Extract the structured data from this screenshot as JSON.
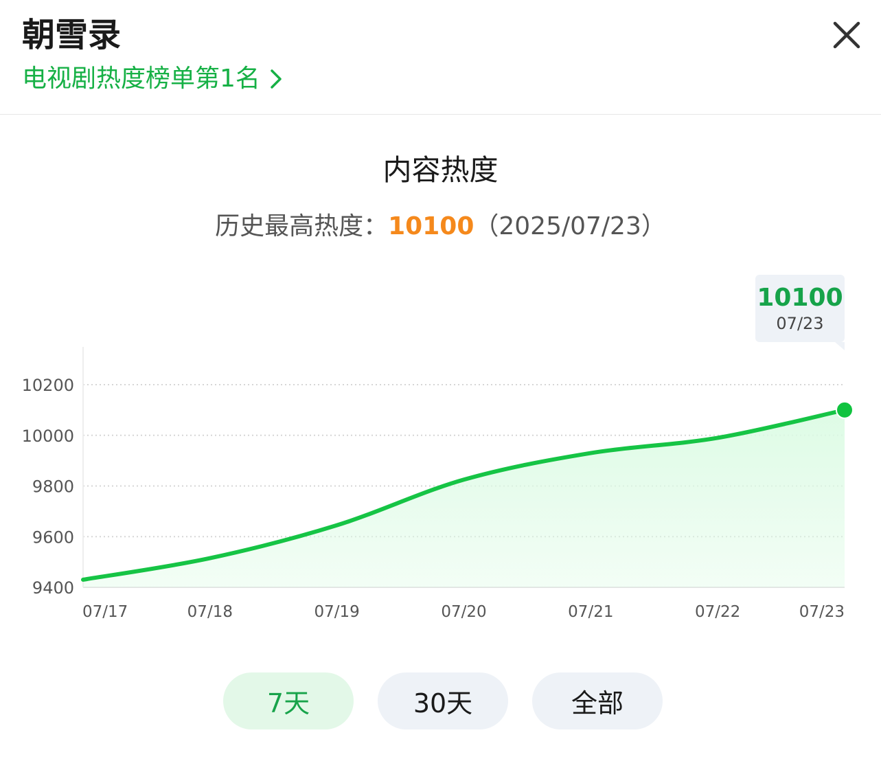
{
  "header": {
    "title": "朝雪录",
    "rank_label": "电视剧热度榜单第1名"
  },
  "section": {
    "title": "内容热度",
    "peak_label": "历史最高热度：",
    "peak_value": "10100",
    "peak_date": "（2025/07/23）"
  },
  "tooltip": {
    "value": "10100",
    "date": "07/23"
  },
  "range_tabs": [
    {
      "label": "7天",
      "active": true
    },
    {
      "label": "30天",
      "active": false
    },
    {
      "label": "全部",
      "active": false
    }
  ],
  "colors": {
    "accent": "#16b045",
    "peak": "#f5891c",
    "line": "#16c445",
    "fill": "#dcfbe4"
  },
  "icons": {
    "rank_link": "chevron-right-icon",
    "close": "close-icon"
  },
  "chart_data": {
    "type": "area",
    "x": [
      "07/17",
      "07/18",
      "07/19",
      "07/20",
      "07/21",
      "07/22",
      "07/23"
    ],
    "y_ticks": [
      9400,
      9600,
      9800,
      10000,
      10200
    ],
    "ylim": [
      9400,
      10200
    ],
    "series": [
      {
        "values": [
          9430,
          9515,
          9645,
          9825,
          9930,
          9990,
          10100
        ]
      }
    ],
    "grid": true,
    "highlight": {
      "x": "07/23",
      "value": 10100
    }
  }
}
